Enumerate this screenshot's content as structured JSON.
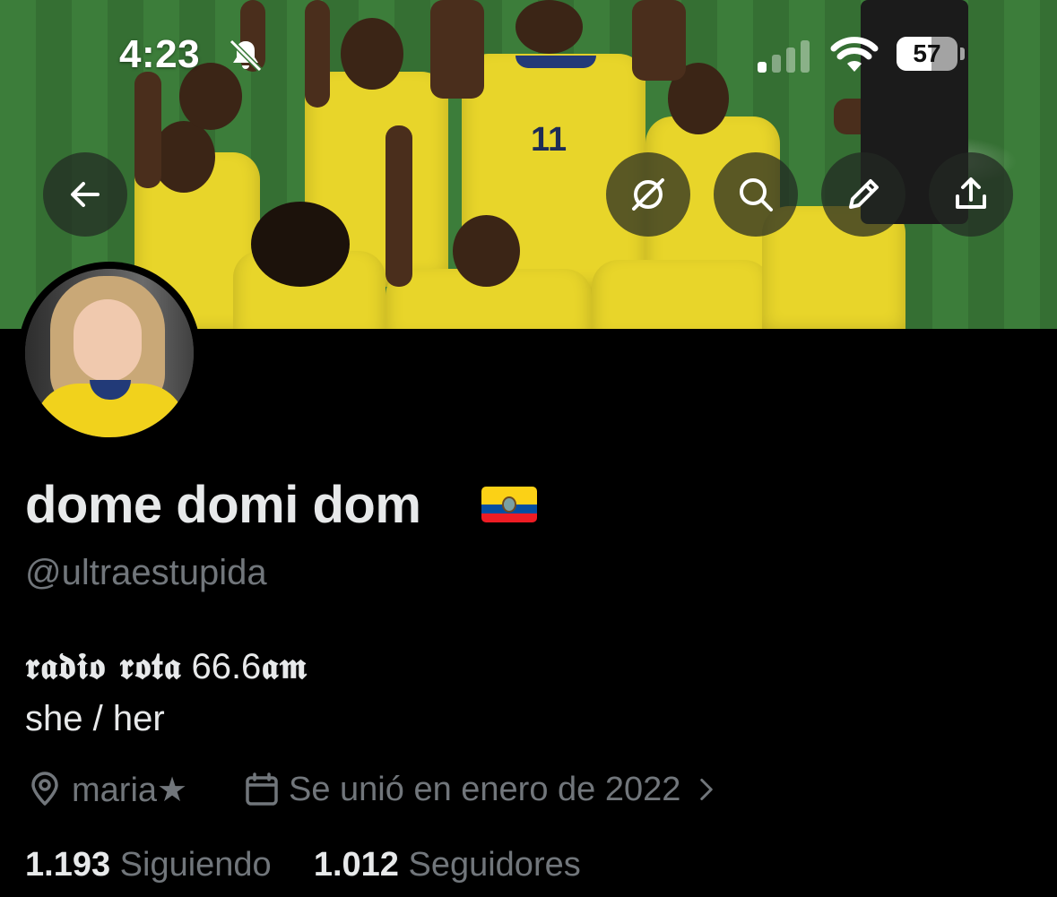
{
  "status_bar": {
    "time": "4:23",
    "bell_icon": "bell-slash-icon",
    "battery": "57",
    "battery_level": 0.57
  },
  "header": {
    "back_icon": "arrow-left-icon",
    "actions": [
      "grok-icon",
      "search-icon",
      "pencil-icon",
      "share-icon"
    ]
  },
  "profile": {
    "name": "dome domi dom",
    "flag": "Ecuador",
    "handle": "@ultraestupida",
    "bio_gothic": "𝖗𝖆𝖉𝖎𝖔 𝖗𝖔𝖙𝖆",
    "bio_freq": "66.6",
    "bio_am": "𝖆𝖒",
    "bio_line2": "she / her",
    "location": "maria★",
    "joined": "Se unió en enero de 2022",
    "following_count": "1.193",
    "following_label": "Siguiendo",
    "followers_count": "1.012",
    "followers_label": "Seguidores"
  },
  "colors": {
    "background": "#000000",
    "text_primary": "#e7e9ea",
    "text_secondary": "#71767b",
    "jersey_yellow": "#e8d52a"
  }
}
